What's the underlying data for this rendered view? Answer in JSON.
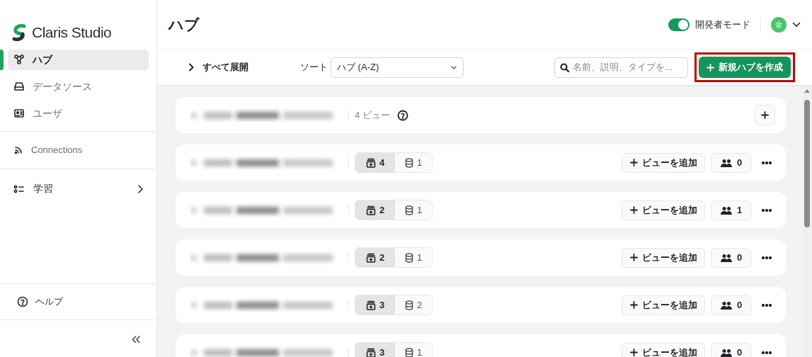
{
  "brand": "Claris Studio",
  "sidebar": {
    "items": [
      {
        "label": "ハブ",
        "selected": true
      },
      {
        "label": "データソース",
        "selected": false
      },
      {
        "label": "ユーザ",
        "selected": false
      }
    ],
    "connections": "Connections",
    "learning": "学習",
    "help": "ヘルプ",
    "collapse": "«"
  },
  "header": {
    "title": "ハブ",
    "developer_mode": {
      "label": "開発者モード",
      "on": true
    },
    "avatar": "金"
  },
  "toolbar": {
    "expand_all": "すべて展開",
    "sort_label": "ソート",
    "sort_value": "ハブ (A-Z)",
    "search_placeholder": "名前、説明、タイプを...",
    "create_button": "新規ハブを作成"
  },
  "hubs": [
    {
      "kind": "summary",
      "views_text": "4 ビュー"
    },
    {
      "kind": "hub",
      "views": "4",
      "sources": "1",
      "users": "0",
      "add_view": "ビューを追加"
    },
    {
      "kind": "hub",
      "views": "2",
      "sources": "1",
      "users": "1",
      "add_view": "ビューを追加"
    },
    {
      "kind": "hub",
      "views": "2",
      "sources": "1",
      "users": "0",
      "add_view": "ビューを追加"
    },
    {
      "kind": "hub",
      "views": "3",
      "sources": "2",
      "users": "0",
      "add_view": "ビューを追加"
    },
    {
      "kind": "hub",
      "views": "3",
      "sources": "1",
      "users": "0",
      "add_view": "ビューを追加"
    }
  ]
}
